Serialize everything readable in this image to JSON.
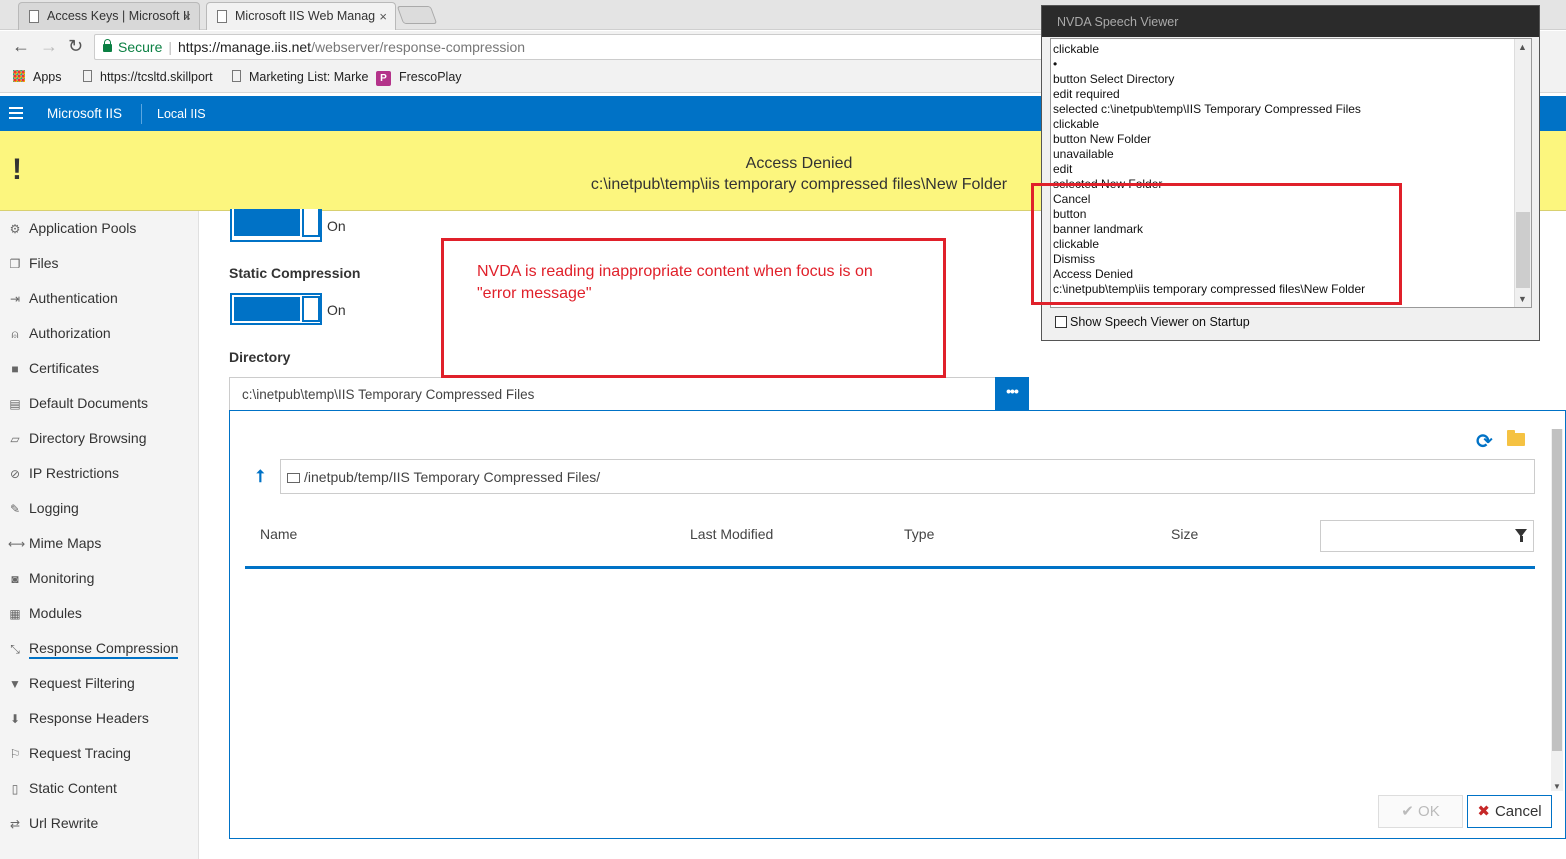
{
  "browser": {
    "tabs": [
      {
        "label": "Access Keys | Microsoft II"
      },
      {
        "label": "Microsoft IIS Web Manag"
      }
    ],
    "address": {
      "secure_label": "Secure",
      "url_host": "https://manage.iis.net",
      "url_path": "/webserver/response-compression"
    },
    "bookmarks": [
      {
        "label": "Apps"
      },
      {
        "label": "https://tcsltd.skillport"
      },
      {
        "label": "Marketing List: Marke"
      },
      {
        "label": "FrescoPlay"
      }
    ]
  },
  "app": {
    "brand": "Microsoft IIS",
    "server": "Local IIS"
  },
  "error": {
    "icon": "!",
    "title": "Access Denied",
    "path": "c:\\inetpub\\temp\\iis temporary compressed files\\New Folder"
  },
  "sidebar": {
    "items": [
      {
        "label": "Application Pools",
        "icon": "gears-icon"
      },
      {
        "label": "Files",
        "icon": "files-icon"
      },
      {
        "label": "Authentication",
        "icon": "sign-in-icon"
      },
      {
        "label": "Authorization",
        "icon": "user-icon"
      },
      {
        "label": "Certificates",
        "icon": "lock-icon"
      },
      {
        "label": "Default Documents",
        "icon": "document-icon"
      },
      {
        "label": "Directory Browsing",
        "icon": "folder-open-icon"
      },
      {
        "label": "IP Restrictions",
        "icon": "ban-icon"
      },
      {
        "label": "Logging",
        "icon": "pencil-icon"
      },
      {
        "label": "Mime Maps",
        "icon": "arrows-h-icon"
      },
      {
        "label": "Monitoring",
        "icon": "camera-icon"
      },
      {
        "label": "Modules",
        "icon": "grid-icon"
      },
      {
        "label": "Response Compression",
        "icon": "compress-icon",
        "active": true
      },
      {
        "label": "Request Filtering",
        "icon": "filter-icon"
      },
      {
        "label": "Response Headers",
        "icon": "arrow-down-icon"
      },
      {
        "label": "Request Tracing",
        "icon": "flag-icon"
      },
      {
        "label": "Static Content",
        "icon": "file-icon"
      },
      {
        "label": "Url Rewrite",
        "icon": "exchange-icon"
      }
    ]
  },
  "main": {
    "dynamic_toggle_label": "On",
    "static_compression_label": "Static Compression",
    "static_toggle_label": "On",
    "directory_label": "Directory",
    "directory_value": "c:\\inetpub\\temp\\IIS Temporary Compressed Files",
    "directory_button": "•••",
    "file_browser": {
      "path": "/inetpub/temp/IIS Temporary Compressed Files/",
      "columns": [
        "Name",
        "Last Modified",
        "Type",
        "Size"
      ],
      "filter_value": "",
      "ok_label": "OK",
      "cancel_label": "Cancel"
    }
  },
  "annotation": {
    "text": "NVDA is reading inappropriate content when focus is on \"error message\""
  },
  "nvda": {
    "title": "NVDA Speech Viewer",
    "lines": [
      "clickable",
      "•",
      "button  Select Directory",
      "edit  required",
      "selected c:\\inetpub\\temp\\IIS Temporary Compressed Files",
      "clickable",
      "button  New Folder",
      "unavailable",
      "edit",
      "selected New Folder",
      "Cancel",
      "button",
      "banner landmark",
      "clickable",
      "Dismiss",
      "Access Denied",
      "c:\\inetpub\\temp\\iis temporary compressed files\\New Folder"
    ],
    "startup_label": "Show Speech Viewer on Startup"
  },
  "colors": {
    "accent": "#0072c6",
    "error_banner": "#fcf67e",
    "annotation": "#e0202a"
  }
}
